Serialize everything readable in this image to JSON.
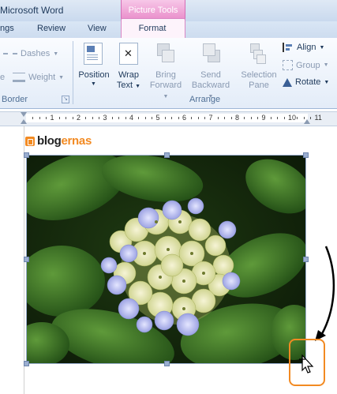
{
  "window": {
    "app_title": "Microsoft Word",
    "contextual_group": "Picture Tools"
  },
  "tabs": [
    {
      "label": "ngs"
    },
    {
      "label": "Review"
    },
    {
      "label": "View"
    },
    {
      "label": "Format",
      "active": true
    }
  ],
  "ribbon": {
    "border_group": {
      "dashes": "Dashes",
      "weight": "Weight",
      "label": "Border",
      "partial_label": "e"
    },
    "arrange_group": {
      "position": "Position",
      "wrap_text_line1": "Wrap",
      "wrap_text_line2": "Text",
      "bring_forward_line1": "Bring",
      "bring_forward_line2": "Forward",
      "send_backward_line1": "Send",
      "send_backward_line2": "Backward",
      "selection_pane_line1": "Selection",
      "selection_pane_line2": "Pane",
      "align": "Align",
      "group": "Group",
      "rotate": "Rotate",
      "label": "Arrange"
    }
  },
  "ruler": {
    "numbers": [
      "1",
      "2",
      "3",
      "4",
      "5",
      "6",
      "7",
      "8",
      "9",
      "10",
      "11"
    ]
  },
  "document": {
    "logo_text_dark": "blog",
    "logo_text_accent": "ernas"
  },
  "colors": {
    "accent_orange": "#f28a22",
    "picture_tools_pink": "#e889c8",
    "ribbon_text": "#1e395b"
  }
}
